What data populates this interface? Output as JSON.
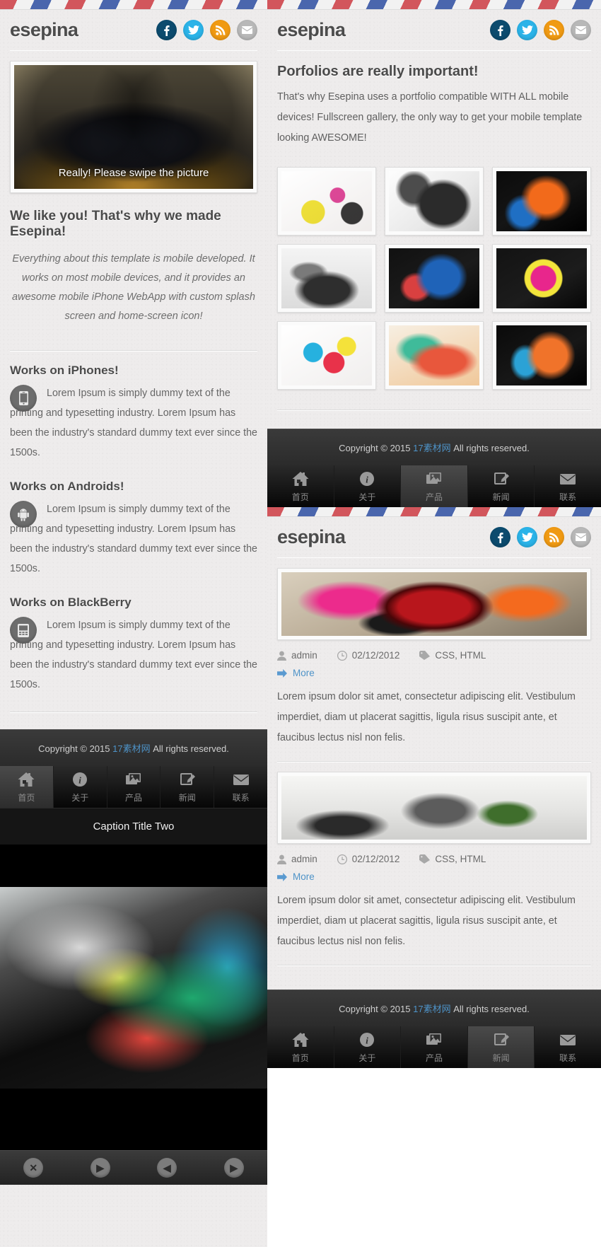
{
  "brand": {
    "logo": "esepina"
  },
  "socials": [
    {
      "name": "facebook",
      "label": "f",
      "color": "#0c4b6e"
    },
    {
      "name": "twitter",
      "label": "t",
      "color": "#2bb3e8"
    },
    {
      "name": "rss",
      "label": "r",
      "color": "#f09a13"
    },
    {
      "name": "mail",
      "label": "m",
      "color": "#b8b8b8"
    }
  ],
  "slider": {
    "caption": "Really! Please swipe the picture"
  },
  "home": {
    "heading": "We like you! That's why we made Esepina!",
    "intro": "Everything about this template is mobile developed. It works on most mobile devices, and it provides an awesome mobile iPhone WebApp with custom splash screen and home-screen icon!",
    "features": [
      {
        "title": "Works on iPhones!",
        "icon": "iphone-icon",
        "text": "Lorem Ipsum is simply dummy text of the printing and typesetting industry. Lorem Ipsum has been the industry's standard dummy text ever since the 1500s."
      },
      {
        "title": "Works on Androids!",
        "icon": "android-icon",
        "text": "Lorem Ipsum is simply dummy text of the printing and typesetting industry. Lorem Ipsum has been the industry's standard dummy text ever since the 1500s."
      },
      {
        "title": "Works on BlackBerry",
        "icon": "blackberry-icon",
        "text": "Lorem Ipsum is simply dummy text of the printing and typesetting industry. Lorem Ipsum has been the industry's standard dummy text ever since the 1500s."
      }
    ]
  },
  "footer": {
    "prefix": "Copyright © 2015 ",
    "link": "17素材网",
    "suffix": " All rights reserved."
  },
  "nav": [
    {
      "label": "首页",
      "icon": "home-icon",
      "active_left": true,
      "active_right": false
    },
    {
      "label": "关于",
      "icon": "info-icon",
      "active_left": false,
      "active_right": false
    },
    {
      "label": "产品",
      "icon": "picture-icon",
      "active_left": false,
      "active_right": true
    },
    {
      "label": "新闻",
      "icon": "pencil-icon",
      "active_left": false,
      "active_right": false
    },
    {
      "label": "联系",
      "icon": "mail-icon",
      "active_left": false,
      "active_right": false
    }
  ],
  "gallery_overlay": {
    "caption": "Caption Title Two"
  },
  "gallery_controls": [
    {
      "name": "close-button",
      "glyph": "✕"
    },
    {
      "name": "play-button",
      "glyph": "▶"
    },
    {
      "name": "prev-button",
      "glyph": "◀"
    },
    {
      "name": "next-button",
      "glyph": "▶"
    }
  ],
  "portfolio": {
    "heading": "Porfolios are really important!",
    "intro": "That's why Esepina uses a portfolio compatible WITH ALL mobile devices! Fullscreen gallery, the only way to get your mobile template looking AWESOME!",
    "thumbs": [
      {
        "name": "portfolio-thumb-1",
        "class": "t1"
      },
      {
        "name": "portfolio-thumb-2",
        "class": "t2"
      },
      {
        "name": "portfolio-thumb-3",
        "class": "t3"
      },
      {
        "name": "portfolio-thumb-4",
        "class": "t4"
      },
      {
        "name": "portfolio-thumb-5",
        "class": "t5"
      },
      {
        "name": "portfolio-thumb-6",
        "class": "t6"
      },
      {
        "name": "portfolio-thumb-7",
        "class": "t7"
      },
      {
        "name": "portfolio-thumb-8",
        "class": "t8"
      },
      {
        "name": "portfolio-thumb-9",
        "class": "t9"
      }
    ]
  },
  "blog": {
    "posts": [
      {
        "image_class": "p1",
        "author": "admin",
        "date": "02/12/2012",
        "tags": "CSS, HTML",
        "more": "More",
        "body": "Lorem ipsum dolor sit amet, consectetur adipiscing elit. Vestibulum imperdiet, diam ut placerat sagittis, ligula risus suscipit ante, et faucibus lectus nisl non felis."
      },
      {
        "image_class": "p2",
        "author": "admin",
        "date": "02/12/2012",
        "tags": "CSS, HTML",
        "more": "More",
        "body": "Lorem ipsum dolor sit amet, consectetur adipiscing elit. Vestibulum imperdiet, diam ut placerat sagittis, ligula risus suscipit ante, et faucibus lectus nisl non felis."
      }
    ]
  }
}
